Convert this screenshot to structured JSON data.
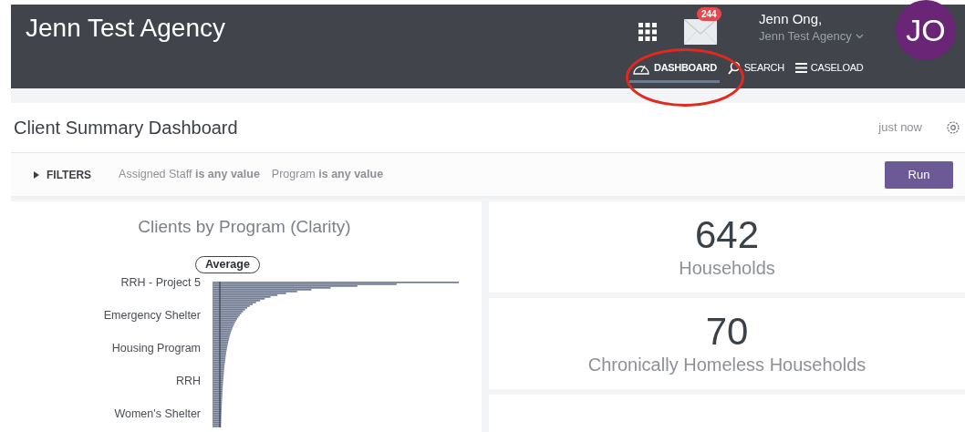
{
  "header": {
    "title": "Jenn Test Agency",
    "notification_count": "244",
    "user_name": "Jenn Ong,",
    "user_agency": "Jenn Test Agency",
    "avatar_initials": "JO"
  },
  "nav": [
    {
      "label": "DASHBOARD",
      "selected": true
    },
    {
      "label": "SEARCH",
      "selected": false
    },
    {
      "label": "CASELOAD",
      "selected": false
    }
  ],
  "dashboard": {
    "title": "Client Summary Dashboard",
    "updated": "just now"
  },
  "filters": {
    "toggle": "FILTERS",
    "expanded": false,
    "items": [
      "Assigned Staff **is any value**",
      "Program **is any value**"
    ],
    "run_button": "Run"
  },
  "chart": {
    "title": "Clients by Program (Clarity)",
    "average_label": "Average",
    "categories": [
      "RRH - Project 5",
      "Emergency Shelter",
      "Housing Program",
      "RRH",
      "Women's Shelter"
    ]
  },
  "tiles": [
    {
      "value": "642",
      "label": "Households"
    },
    {
      "value": "70",
      "label": "Chronically Homeless Households"
    }
  ]
}
